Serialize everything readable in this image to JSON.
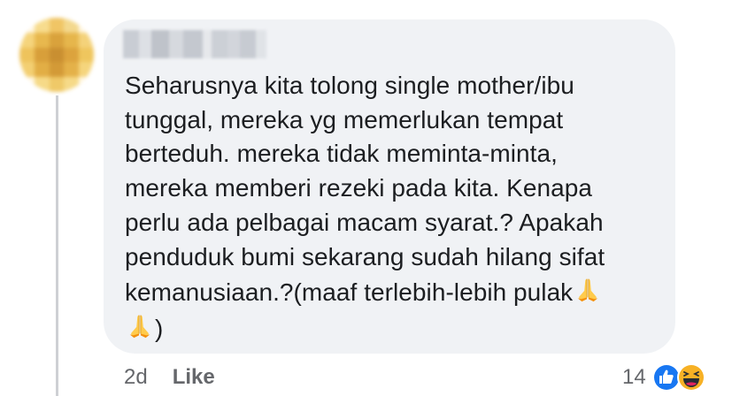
{
  "comment": {
    "author_blurred": true,
    "lines": [
      "Seharusnya kita tolong single mother/ibu",
      "tunggal, mereka yg memerlukan tempat",
      "berteduh. mereka tidak meminta-minta,",
      "mereka memberi rezeki pada kita. Kenapa",
      "perlu ada pelbagai macam syarat.? Apakah",
      "penduduk bumi sekarang sudah hilang sifat",
      "kemanusiaan.?(maaf terlebih-lebih pulak"
    ],
    "last_line_suffix": ")",
    "emoji": "folded-hands"
  },
  "meta": {
    "time": "2d",
    "like_label": "Like"
  },
  "reactions": {
    "count": "14",
    "icons": [
      "like-reaction-icon",
      "haha-reaction-icon"
    ]
  },
  "colors": {
    "bubble": "#f0f2f5",
    "text": "#1c1e21",
    "meta": "#65676b",
    "like_blue": "#1877f2",
    "haha_yellow": "#f7b125",
    "thread_line": "#ced0d4"
  }
}
